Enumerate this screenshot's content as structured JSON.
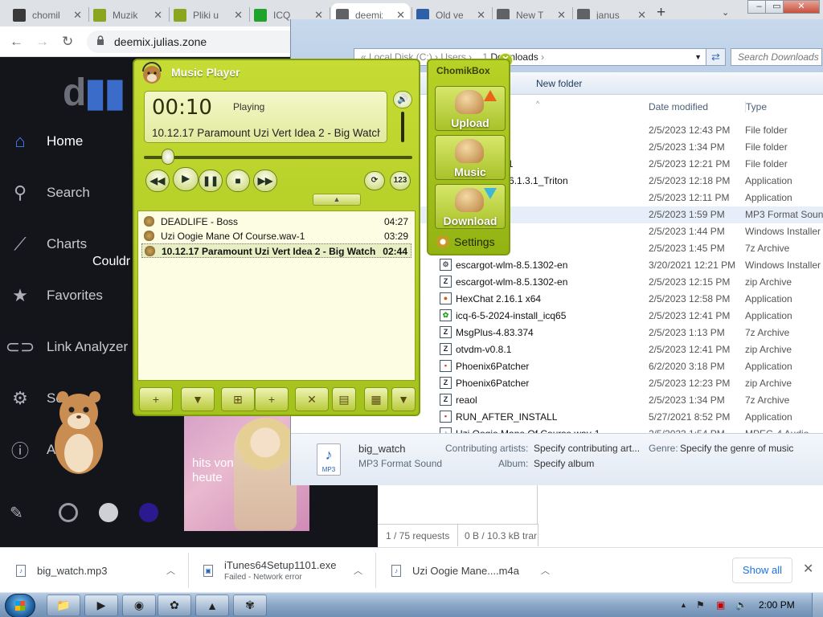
{
  "browser": {
    "tabs": [
      {
        "title": "chomik",
        "favicon": "chomikuj-icon",
        "color": "#3a3a3a"
      },
      {
        "title": "Muzik",
        "favicon": "hamster-icon",
        "color": "#8aa51e"
      },
      {
        "title": "Pliki u",
        "favicon": "hamster-icon",
        "color": "#8aa51e"
      },
      {
        "title": "ICQ",
        "favicon": "icq-flower-icon",
        "color": "#1fa32b"
      },
      {
        "title": "deemix",
        "favicon": "globe-icon",
        "color": "#5f6368"
      },
      {
        "title": "Old ve",
        "favicon": "oldversion-icon",
        "color": "#2f5fa6"
      },
      {
        "title": "New T",
        "favicon": "chrome-icon",
        "color": "#5f6368"
      },
      {
        "title": "janus",
        "favicon": "globe-icon",
        "color": "#5f6368"
      }
    ],
    "active_tab": 4,
    "url": "deemix.julias.zone"
  },
  "deemix": {
    "logo_letter": "d",
    "nav": [
      {
        "label": "Home",
        "icon": "home-icon"
      },
      {
        "label": "Search",
        "icon": "search-icon"
      },
      {
        "label": "Charts",
        "icon": "trending-icon"
      },
      {
        "label": "Favorites",
        "icon": "star-icon"
      },
      {
        "label": "Link Analyzer",
        "icon": "link-icon"
      },
      {
        "label": "Se",
        "icon": "gear-icon"
      },
      {
        "label": "Ab",
        "icon": "info-icon"
      }
    ],
    "overlay_text": "Couldr",
    "album_caption": "hits von heute",
    "swatches": [
      "#14151b",
      "#cfd0d4",
      "#2b1a8f"
    ]
  },
  "explorer": {
    "breadcrumb": {
      "prefix": "« Local Disk (C:) › Users › ...1",
      "current": "Downloads"
    },
    "search_placeholder": "Search Downloads",
    "new_folder": "New folder",
    "columns": {
      "date": "Date modified",
      "type": "Type"
    },
    "files": [
      {
        "name": "re",
        "date": "2/5/2023 12:43 PM",
        "type": "File folder",
        "icon": ""
      },
      {
        "name": "",
        "date": "2/5/2023 1:34 PM",
        "type": "File folder",
        "icon": ""
      },
      {
        "name": "nstall_6.1.3.1",
        "date": "2/5/2023 12:21 PM",
        "type": "File folder",
        "icon": ""
      },
      {
        "name": "Messenger_6.1.3.1_Triton",
        "date": "2/5/2023 12:18 PM",
        "type": "Application",
        "icon": ""
      },
      {
        "name": "",
        "date": "2/5/2023 12:11 PM",
        "type": "Application",
        "icon": ""
      },
      {
        "name": "",
        "date": "2/5/2023 1:59 PM",
        "type": "MP3 Format Sound",
        "icon": ""
      },
      {
        "name": "",
        "date": "2/5/2023 1:44 PM",
        "type": "Windows Installer ...",
        "icon": ""
      },
      {
        "name": "",
        "date": "2/5/2023 1:45 PM",
        "type": "7z Archive",
        "icon": ""
      },
      {
        "name": "escargot-wlm-8.5.1302-en",
        "date": "3/20/2021 12:21 PM",
        "type": "Windows Installer ...",
        "icon": "installer"
      },
      {
        "name": "escargot-wlm-8.5.1302-en",
        "date": "2/5/2023 12:15 PM",
        "type": "zip Archive",
        "icon": "zip"
      },
      {
        "name": "HexChat 2.16.1 x64",
        "date": "2/5/2023 12:58 PM",
        "type": "Application",
        "icon": "hexchat"
      },
      {
        "name": "icq-6-5-2024-install_icq65",
        "date": "2/5/2023 12:41 PM",
        "type": "Application",
        "icon": "icq"
      },
      {
        "name": "MsgPlus-4.83.374",
        "date": "2/5/2023 1:13 PM",
        "type": "7z Archive",
        "icon": "7z"
      },
      {
        "name": "otvdm-v0.8.1",
        "date": "2/5/2023 12:41 PM",
        "type": "zip Archive",
        "icon": "zip"
      },
      {
        "name": "Phoenix6Patcher",
        "date": "6/2/2020 3:18 PM",
        "type": "Application",
        "icon": "app"
      },
      {
        "name": "Phoenix6Patcher",
        "date": "2/5/2023 12:23 PM",
        "type": "zip Archive",
        "icon": "zip"
      },
      {
        "name": "reaol",
        "date": "2/5/2023 1:34 PM",
        "type": "7z Archive",
        "icon": "7z"
      },
      {
        "name": "RUN_AFTER_INSTALL",
        "date": "5/27/2021 8:52 PM",
        "type": "Application",
        "icon": "app"
      },
      {
        "name": "Uzi Oogie Mane Of Course.wav-1",
        "date": "2/5/2023 1:54 PM",
        "type": "MPEG-4 Audio",
        "icon": "audio"
      }
    ],
    "selected_row": 5,
    "details": {
      "filename": "big_watch",
      "filetype": "MP3 Format Sound",
      "contributing_label": "Contributing artists:",
      "contributing_value": "Specify contributing art...",
      "album_label": "Album:",
      "album_value": "Specify album",
      "genre_label": "Genre:",
      "genre_value": "Specify the genre of music",
      "icon_caption": "MP3"
    }
  },
  "devtools": {
    "requests": "1 / 75 requests",
    "transfer": "0 B / 10.3 kB trar"
  },
  "music_player": {
    "title": "Music Player",
    "time": "00:10",
    "status": "Playing",
    "now_playing": "10.12.17 Paramount Uzi Vert Idea 2 - Big Watch",
    "seek_progress": 0.09,
    "controls": [
      {
        "name": "rewind-button",
        "glyph": "◀◀"
      },
      {
        "name": "play-button",
        "glyph": "▶"
      },
      {
        "name": "pause-button",
        "glyph": "❚❚"
      },
      {
        "name": "stop-button",
        "glyph": "■"
      },
      {
        "name": "forward-button",
        "glyph": "▶▶"
      },
      {
        "name": "repeat-button",
        "glyph": "⟳"
      },
      {
        "name": "shuffle-button",
        "glyph": "123"
      }
    ],
    "playlist": [
      {
        "title": "DEADLIFE - Boss",
        "duration": "04:27"
      },
      {
        "title": "Uzi Oogie Mane Of Course.wav-1",
        "duration": "03:29"
      },
      {
        "title": "10.12.17 Paramount Uzi Vert Idea 2 - Big Watch",
        "duration": "02:44"
      }
    ],
    "current_index": 2,
    "toolbar": [
      {
        "name": "add-track-button",
        "glyph": "+"
      },
      {
        "name": "sort-button",
        "glyph": "▼"
      },
      {
        "name": "add-files-button",
        "glyph": "⊞"
      },
      {
        "name": "add-folder-button",
        "glyph": "+"
      },
      {
        "name": "remove-button",
        "glyph": "✕"
      },
      {
        "name": "new-playlist-button",
        "glyph": "▤"
      },
      {
        "name": "save-playlist-button",
        "glyph": "▦"
      },
      {
        "name": "playlist-menu-button",
        "glyph": "▼"
      }
    ],
    "accent": "#a3c21b"
  },
  "chomikbox": {
    "title": "ChomikBox",
    "upload": "Upload",
    "music": "Music",
    "download": "Download",
    "settings": "Settings"
  },
  "downloads_shelf": {
    "items": [
      {
        "name": "big_watch.mp3",
        "sub": ""
      },
      {
        "name": "iTunes64Setup1101.exe",
        "sub": "Failed - Network error"
      },
      {
        "name": "Uzi Oogie Mane....m4a",
        "sub": ""
      }
    ],
    "show_all": "Show all"
  },
  "taskbar": {
    "clock": "2:00 PM"
  }
}
